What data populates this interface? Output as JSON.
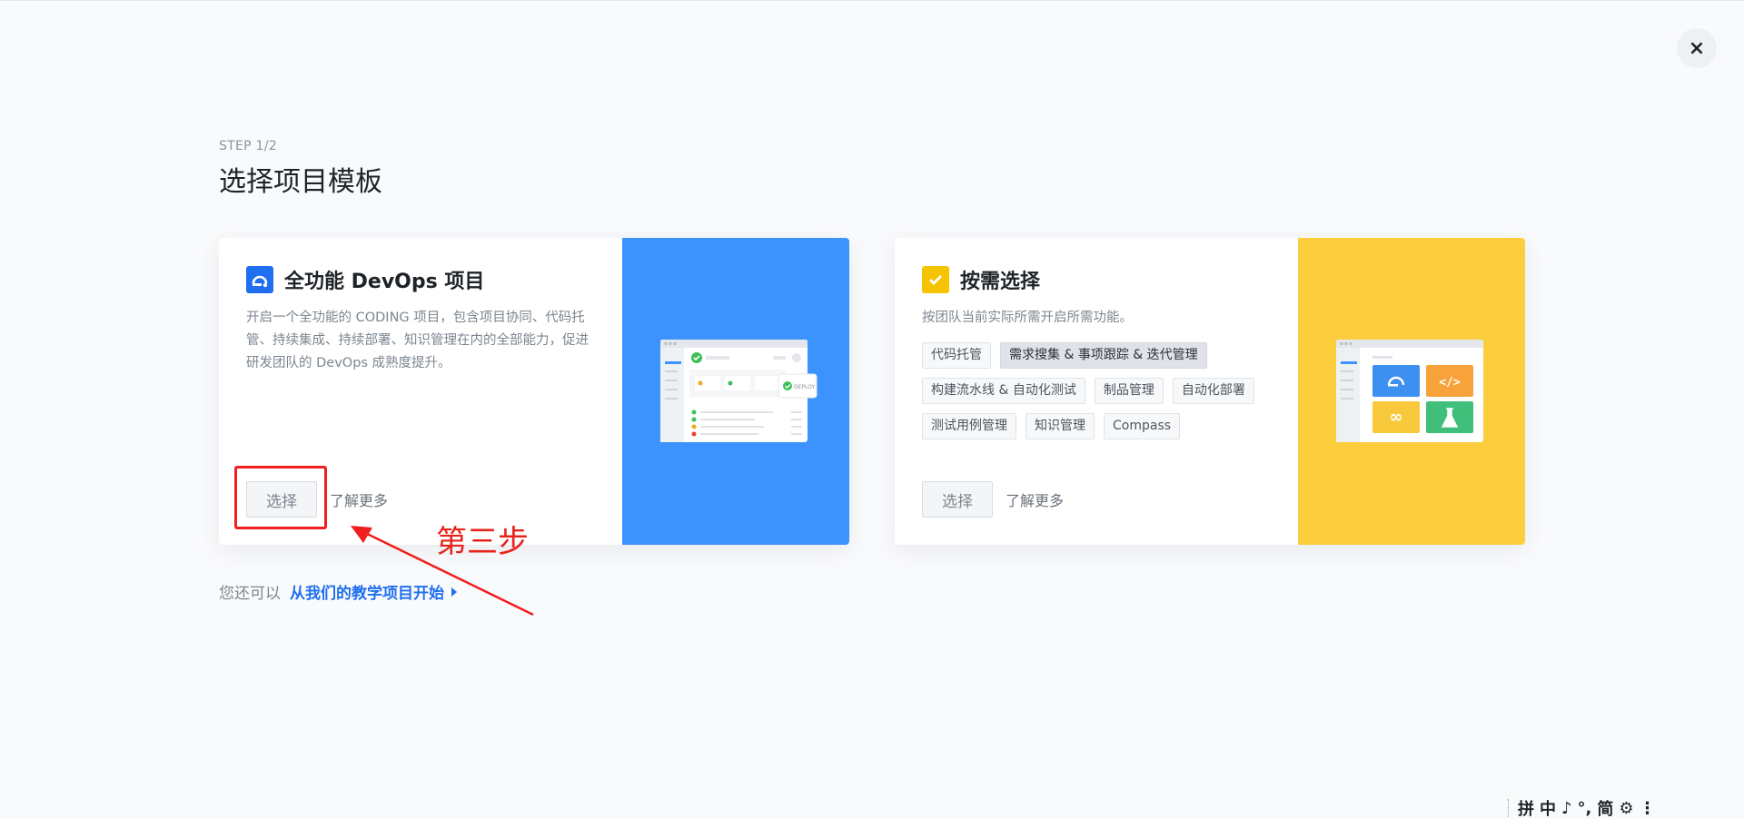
{
  "step": "STEP 1/2",
  "title": "选择项目模板",
  "close_glyph": "×",
  "cards": [
    {
      "title": "全功能 DevOps 项目",
      "icon": "devops-logo-icon",
      "description": "开启一个全功能的 CODING 项目，包含项目协同、代码托管、持续集成、持续部署、知识管理在内的全部能力，促进研发团队的 DevOps 成熟度提升。",
      "select_label": "选择",
      "learn_more": "了解更多",
      "art_color": "#3d93fd",
      "deploy_label": "DEPLOY"
    },
    {
      "title": "按需选择",
      "icon": "checkbox-icon",
      "description": "按团队当前实际所需开启所需功能。",
      "tags": [
        "代码托管",
        "需求搜集 & 事项跟踪 & 迭代管理",
        "构建流水线 & 自动化测试",
        "制品管理",
        "自动化部署",
        "测试用例管理",
        "知识管理",
        "Compass"
      ],
      "active_tag_index": 1,
      "select_label": "选择",
      "learn_more": "了解更多",
      "art_color": "#fccd3d"
    }
  ],
  "footer": {
    "prefix": "您还可以",
    "link": "从我们的教学项目开始"
  },
  "annotation": {
    "label": "第三步",
    "color": "#e8231a"
  },
  "ime": [
    "拼",
    "中",
    "♪",
    "°,",
    "简",
    "⚙",
    "⋮"
  ],
  "colors": {
    "accent": "#1f6ff0",
    "blue_art": "#3d93fd",
    "yellow_art": "#fccd3d",
    "annotation_red": "#f21d1d"
  }
}
